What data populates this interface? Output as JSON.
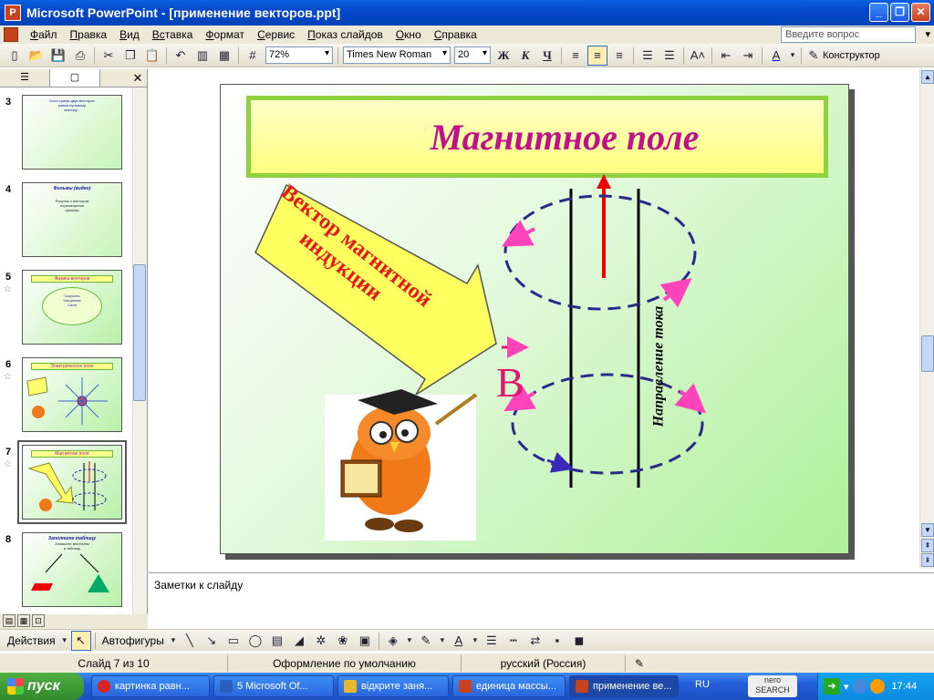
{
  "window": {
    "title": "Microsoft PowerPoint - [применение векторов.ppt]"
  },
  "menu": {
    "items": [
      {
        "u": "Ф",
        "rest": "айл"
      },
      {
        "u": "П",
        "rest": "равка"
      },
      {
        "u": "В",
        "rest": "ид"
      },
      {
        "u": "Вс",
        "rest": "тавка"
      },
      {
        "u": "Ф",
        "rest": "ормат"
      },
      {
        "u": "С",
        "rest": "ервис"
      },
      {
        "u": "П",
        "rest": "оказ слайдов"
      },
      {
        "u": "О",
        "rest": "кно"
      },
      {
        "u": "С",
        "rest": "правка"
      }
    ],
    "help_placeholder": "Введите вопрос"
  },
  "toolbar": {
    "zoom": "72%",
    "font": "Times New Roman",
    "size": "20",
    "bold": "Ж",
    "italic": "К",
    "underline": "Ч",
    "designer": "Конструктор"
  },
  "slides": [
    {
      "num": "3",
      "lines": [
        "Если сумма двух векторов",
        "равна нулевому",
        "вектору..."
      ]
    },
    {
      "num": "4",
      "title": "Фильмы (видео)",
      "lines": [
        "Рисунок с вектором",
        "перемещения",
        "фильма"
      ]
    },
    {
      "num": "5",
      "title": "Физика векторов",
      "lines": [
        "Скорость",
        "Ускорение",
        "Сила"
      ]
    },
    {
      "num": "6",
      "title": "Электрическое поле",
      "lines": []
    },
    {
      "num": "7",
      "title": "Магнитное поле",
      "lines": []
    },
    {
      "num": "8",
      "title": "Заполните таблицу",
      "lines": [
        "Запишите величины",
        "в таблицу"
      ]
    }
  ],
  "slide": {
    "title": "Магнитное поле",
    "arrow_text": "Вектор магнитной индукции",
    "vector_letter": "B",
    "current_label": "Направление тока",
    "colors": {
      "title": "#c0108a",
      "arrow_fill": "#ffff60",
      "arrow_text": "#e21a1a",
      "field": "#2a2a8a",
      "vector": "#e0166e"
    }
  },
  "notes": {
    "placeholder": "Заметки к слайду"
  },
  "drawing": {
    "actions": "Действия",
    "autoshapes": "Автофигуры"
  },
  "status": {
    "slide": "Слайд 7 из 10",
    "design": "Оформление по умолчанию",
    "language": "русский (Россия)"
  },
  "taskbar": {
    "start": "пуск",
    "tasks": [
      {
        "label": "картинка равн...",
        "color": "#d22"
      },
      {
        "label": "5 Microsoft Of...",
        "color": "#2b5fbf"
      },
      {
        "label": "відкрите заня...",
        "color": "#e8b82a"
      },
      {
        "label": "единица массы...",
        "color": "#c8421d"
      },
      {
        "label": "применение ве...",
        "color": "#c8421d"
      }
    ],
    "lang": "RU",
    "nero": "nero SEARCH",
    "clock": "17:44"
  }
}
